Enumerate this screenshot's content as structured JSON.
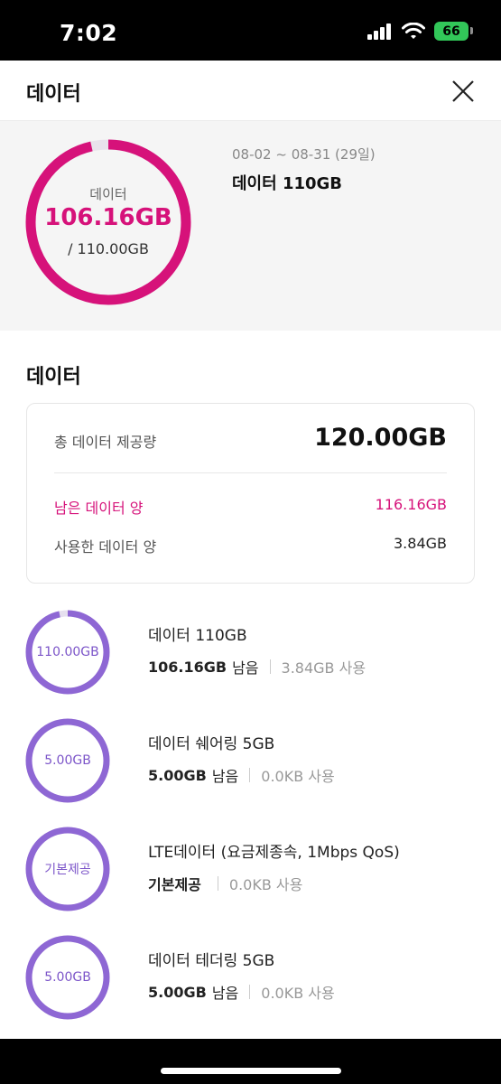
{
  "status_bar": {
    "time": "7:02",
    "battery": "66"
  },
  "header": {
    "title": "데이터"
  },
  "summary": {
    "ring_label": "데이터",
    "remaining": "106.16GB",
    "total": "/ 110.00GB",
    "remaining_fraction": 0.965,
    "period": "08-02 ~ 08-31 (29일)",
    "plan": "데이터 110GB"
  },
  "section": {
    "title": "데이터"
  },
  "card": {
    "total_label": "총 데이터 제공량",
    "total_value": "120.00GB",
    "remaining_label": "남은 데이터 양",
    "remaining_value": "116.16GB",
    "used_label": "사용한 데이터 양",
    "used_value": "3.84GB"
  },
  "items": [
    {
      "ring_label": "110.00GB",
      "title": "데이터 110GB",
      "remaining": "106.16GB",
      "remaining_suffix": "남음",
      "used": "3.84GB 사용",
      "fraction": 0.965
    },
    {
      "ring_label": "5.00GB",
      "title": "데이터 쉐어링 5GB",
      "remaining": "5.00GB",
      "remaining_suffix": "남음",
      "used": "0.0KB 사용",
      "fraction": 1.0
    },
    {
      "ring_label": "기본제공",
      "title": "LTE데이터 (요금제종속, 1Mbps QoS)",
      "remaining": "기본제공",
      "remaining_suffix": "",
      "used": "0.0KB 사용",
      "fraction": 1.0
    },
    {
      "ring_label": "5.00GB",
      "title": "데이터 테더링 5GB",
      "remaining": "5.00GB",
      "remaining_suffix": "남음",
      "used": "0.0KB 사용",
      "fraction": 1.0
    }
  ],
  "colors": {
    "accent": "#d6127a",
    "ring_purple": "#8e67d4",
    "ring_track": "#e6e0ef"
  }
}
